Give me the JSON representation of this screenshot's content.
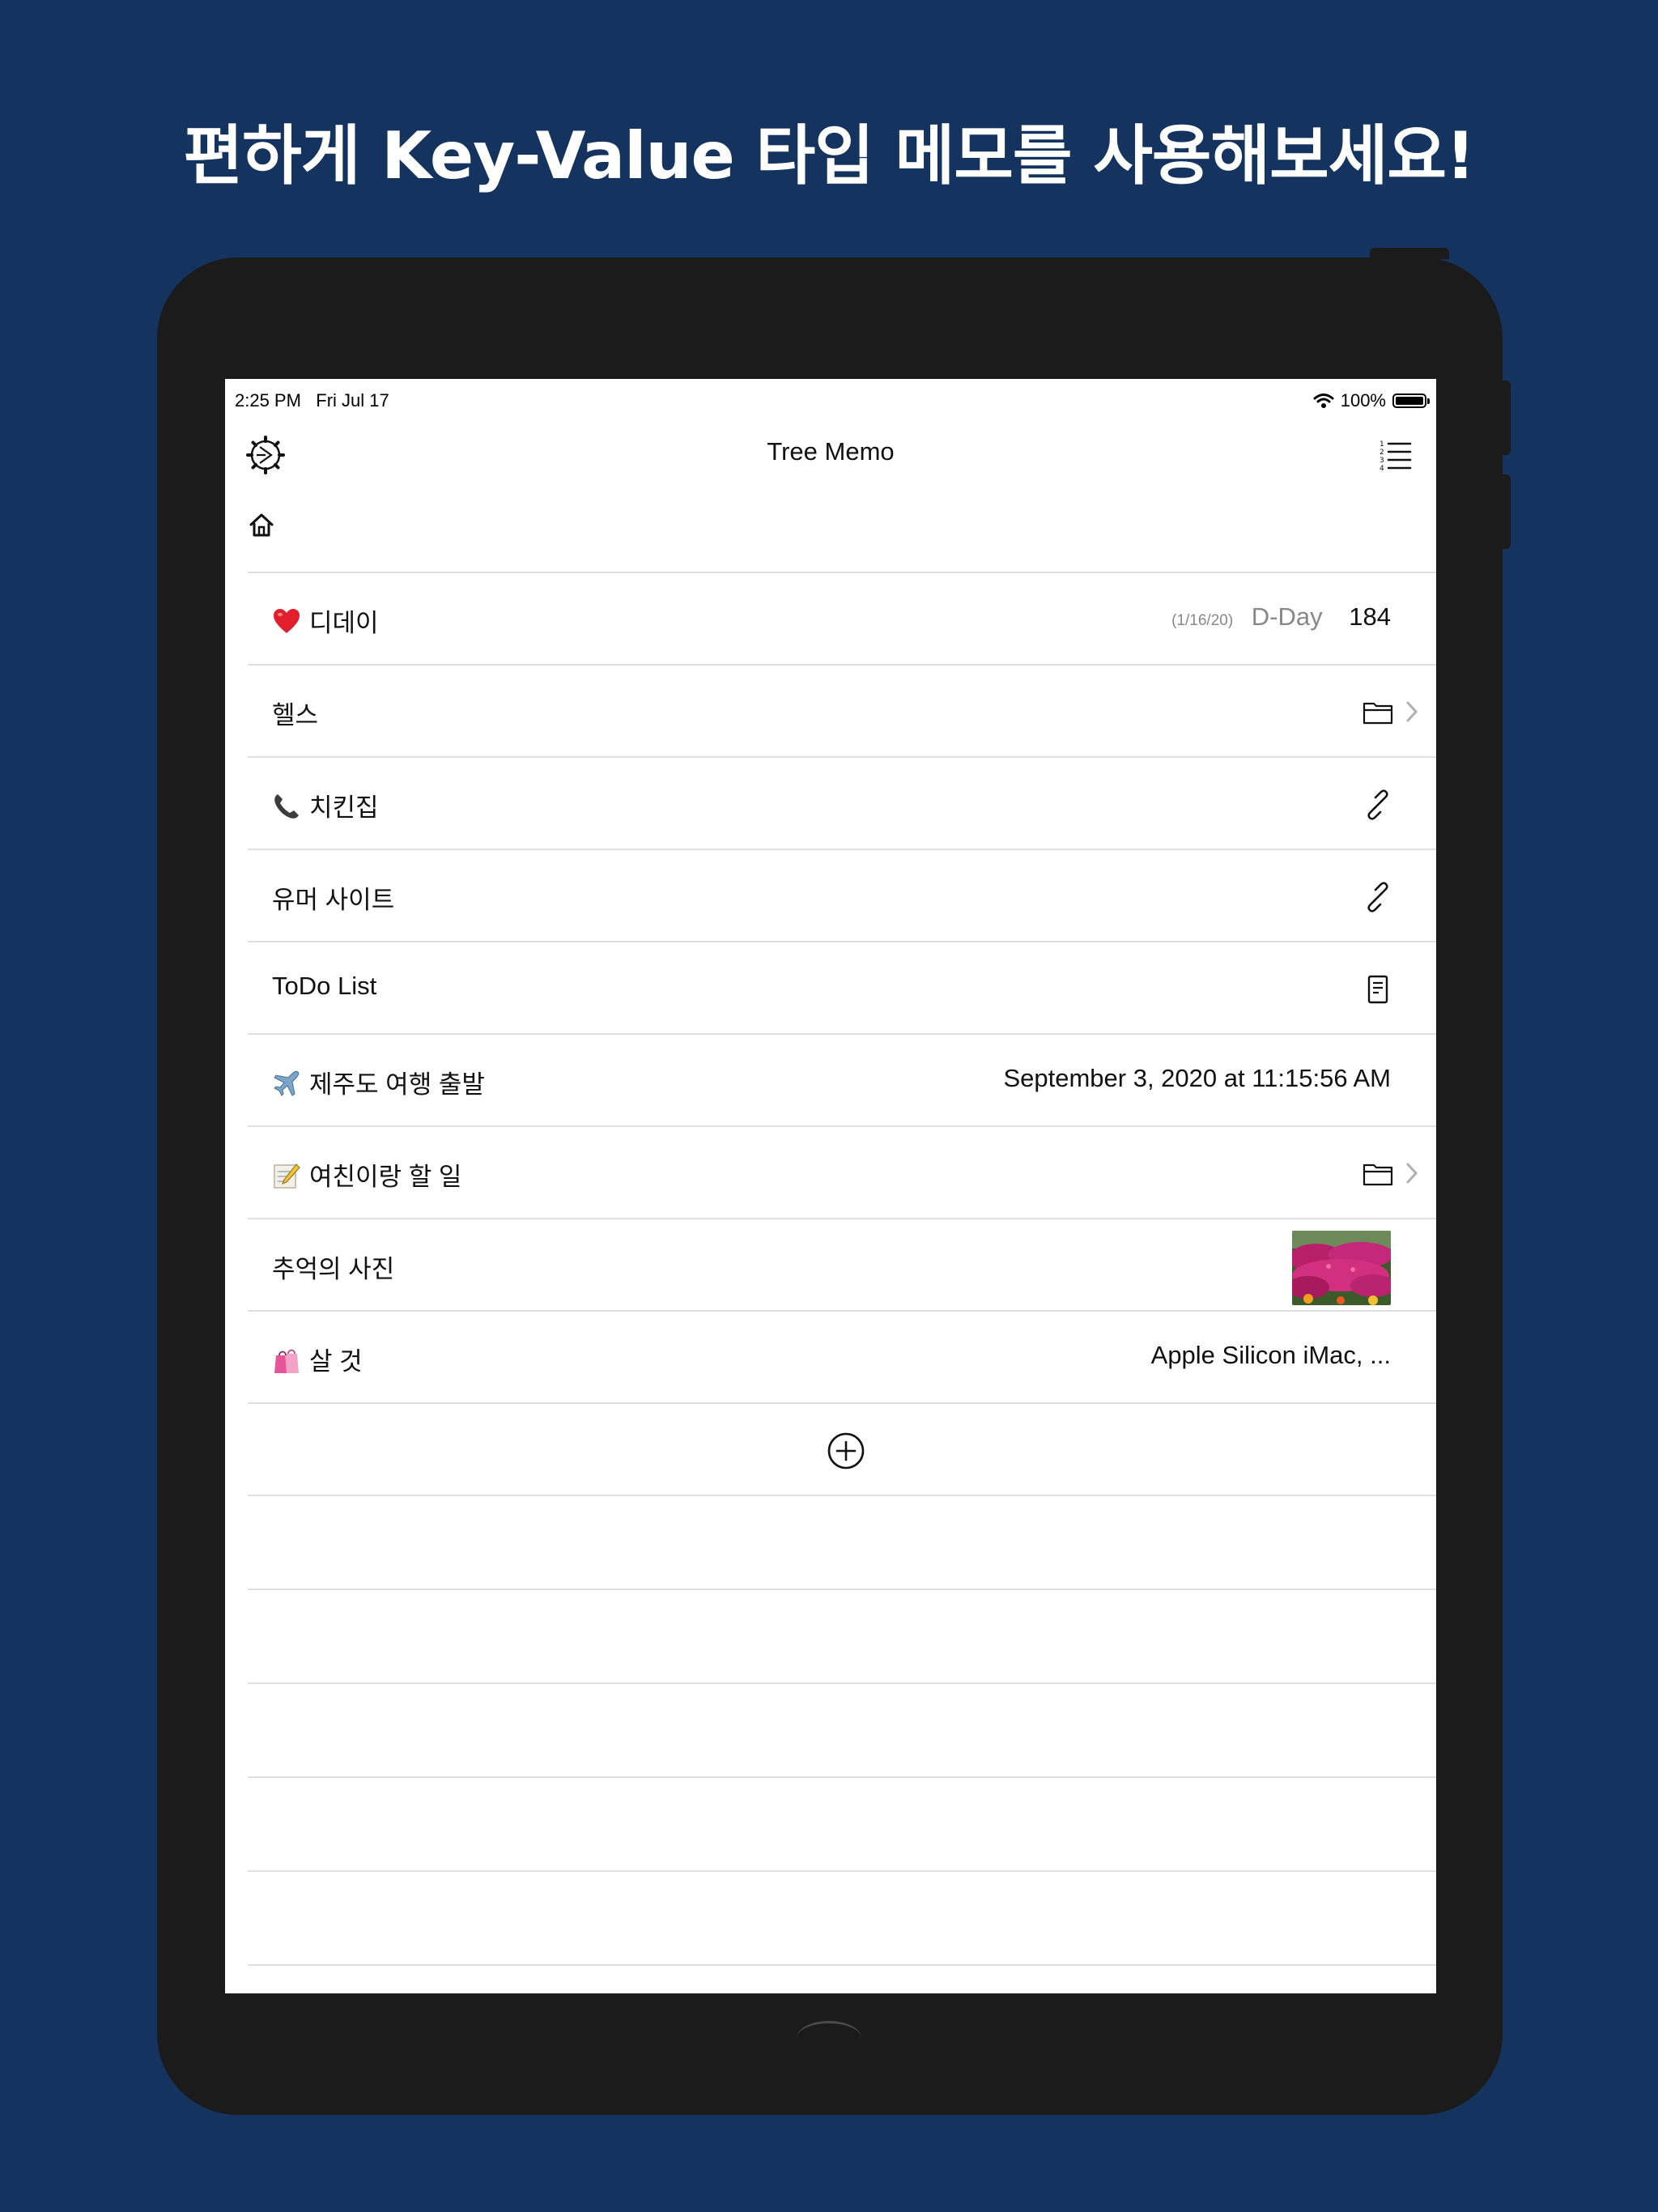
{
  "headline": "편하게 Key-Value 타입 메모를 사용해보세요!",
  "status_bar": {
    "time": "2:25 PM",
    "date": "Fri Jul 17",
    "battery": "100%",
    "battery_level": 1.0
  },
  "navbar": {
    "title": "Tree Memo",
    "left_icon": "gear-icon",
    "right_icon": "numbered-list-icon"
  },
  "breadcrumb": {
    "icon": "home-icon"
  },
  "rows": [
    {
      "key": "디데이",
      "emoji": "red-heart",
      "dday_date": "(1/16/20)",
      "dday_label": "D-Day",
      "value": "184"
    },
    {
      "key": "헬스",
      "type": "folder"
    },
    {
      "key": "치킨집",
      "emoji": "telephone-receiver",
      "type": "link"
    },
    {
      "key": "유머 사이트",
      "type": "link"
    },
    {
      "key": "ToDo List",
      "type": "document"
    },
    {
      "key": "제주도 여행 출발",
      "emoji": "airplane",
      "value": "September 3, 2020 at 11:15:56 AM"
    },
    {
      "key": "여친이랑 할 일",
      "emoji": "memo",
      "type": "folder"
    },
    {
      "key": "추억의 사진",
      "type": "photo"
    },
    {
      "key": "살 것",
      "emoji": "shopping-bags",
      "value": "Apple Silicon iMac, ..."
    }
  ],
  "add_icon": "plus-circle-icon",
  "colors": {
    "background": "#14335f",
    "device": "#1b1b1b",
    "screen": "#ffffff",
    "separator": "#e0e0e0",
    "secondary_text": "#888888"
  }
}
